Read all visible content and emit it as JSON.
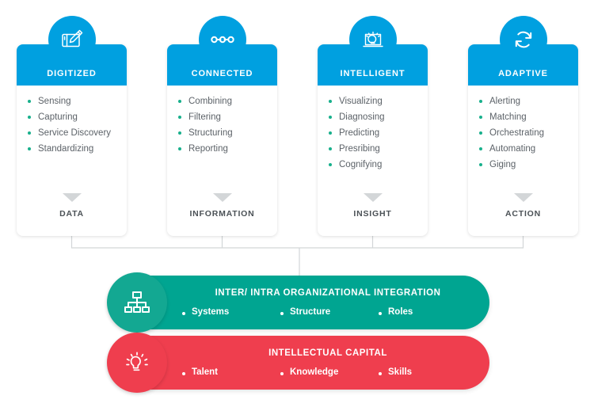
{
  "theme": {
    "blue": "#00a0e0",
    "green": "#00a591",
    "red": "#ef3e4e",
    "bullet_green": "#18b08c",
    "text_gray": "#5c6268",
    "connector_gray": "#d3d6d8"
  },
  "pillars": [
    {
      "title": "DIGITIZED",
      "icon": "tablet-stylus-icon",
      "items": [
        "Sensing",
        "Capturing",
        "Service Discovery",
        "Standardizing"
      ],
      "outcome": "DATA"
    },
    {
      "title": "CONNECTED",
      "icon": "nodes-link-icon",
      "items": [
        "Combining",
        "Filtering",
        "Structuring",
        "Reporting"
      ],
      "outcome": "INFORMATION"
    },
    {
      "title": "INTELLIGENT",
      "icon": "lightbulb-laptop-icon",
      "items": [
        "Visualizing",
        "Diagnosing",
        "Predicting",
        "Presribing",
        "Cognifying"
      ],
      "outcome": "INSIGHT"
    },
    {
      "title": "ADAPTIVE",
      "icon": "sync-refresh-icon",
      "items": [
        "Alerting",
        "Matching",
        "Orchestrating",
        "Automating",
        "Giging"
      ],
      "outcome": "ACTION"
    }
  ],
  "bars": [
    {
      "title": "INTER/ INTRA ORGANIZATIONAL  INTEGRATION",
      "icon": "org-chart-icon",
      "items": [
        "Systems",
        "Structure",
        "Roles"
      ]
    },
    {
      "title": "INTELLECTUAL CAPITAL",
      "icon": "lightbulb-rays-icon",
      "items": [
        "Talent",
        "Knowledge",
        "Skills"
      ]
    }
  ]
}
